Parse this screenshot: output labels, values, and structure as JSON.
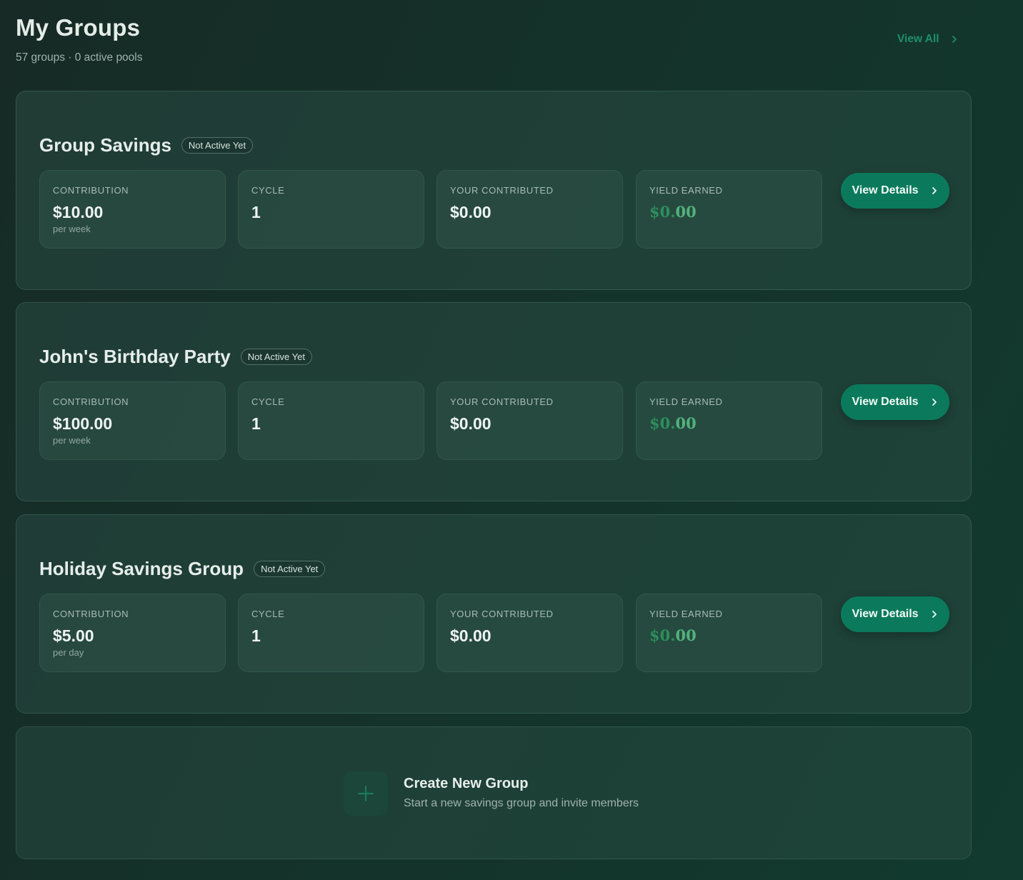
{
  "header": {
    "title": "My Groups",
    "subtitle": "57 groups · 0 active pools",
    "view_all_label": "View All"
  },
  "stat_labels": {
    "contribution": "CONTRIBUTION",
    "cycle": "CYCLE",
    "your_contributed": "YOUR CONTRIBUTED",
    "yield_earned": "YIELD EARNED"
  },
  "groups": [
    {
      "name": "Group Savings",
      "status": "Not Active Yet",
      "contribution": "$10.00",
      "frequency": "per week",
      "cycle": "1",
      "your_contributed": "$0.00",
      "yield_dollars": "$0.",
      "yield_cents": "00",
      "view_details_label": "View Details"
    },
    {
      "name": "John's Birthday Party",
      "status": "Not Active Yet",
      "contribution": "$100.00",
      "frequency": "per week",
      "cycle": "1",
      "your_contributed": "$0.00",
      "yield_dollars": "$0.",
      "yield_cents": "00",
      "view_details_label": "View Details"
    },
    {
      "name": "Holiday Savings Group",
      "status": "Not Active Yet",
      "contribution": "$5.00",
      "frequency": "per day",
      "cycle": "1",
      "your_contributed": "$0.00",
      "yield_dollars": "$0.",
      "yield_cents": "00",
      "view_details_label": "View Details"
    }
  ],
  "create": {
    "title": "Create New Group",
    "subtitle": "Start a new savings group and invite members",
    "icon": "plus-icon"
  },
  "colors": {
    "accent": "#0b7a5c",
    "link": "#1f8f6a",
    "yield": "#2c8f5c"
  }
}
